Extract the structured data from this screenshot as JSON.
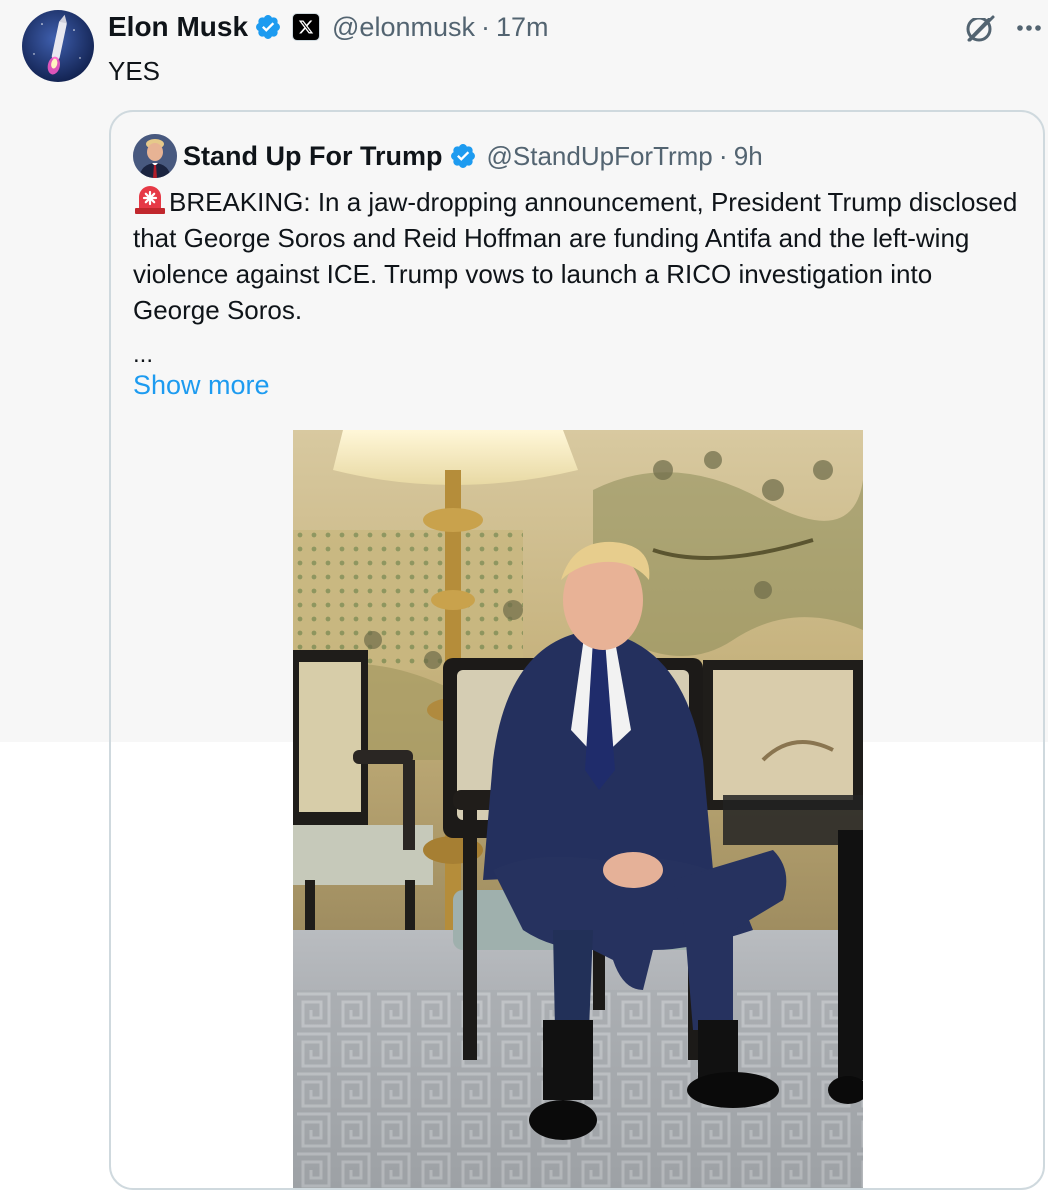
{
  "post": {
    "author": {
      "display_name": "Elon Musk",
      "handle": "@elonmusk",
      "verified": true,
      "affiliation_icon": "x-logo-icon"
    },
    "separator": "·",
    "time": "17m",
    "text": "YES",
    "actions": {
      "grok_icon": "grok-icon",
      "more_icon": "more-dots-icon"
    }
  },
  "quoted_post": {
    "author": {
      "display_name": "Stand Up For Trump",
      "handle": "@StandUpForTrmp",
      "verified": true
    },
    "separator": "·",
    "time": "9h",
    "alert_icon": "rotating-light-emoji",
    "text": "BREAKING: In a jaw-dropping announcement, President Trump disclosed that George Soros and Reid Hoffman are funding Antifa and the left-wing violence against ICE. Trump vows to launch a RICO investigation into George Soros.",
    "ellipsis": "...",
    "show_more_label": "Show more",
    "media": "photo"
  },
  "colors": {
    "accent": "#1d9bf0",
    "secondary_text": "#536471",
    "primary_text": "#0f1419",
    "border": "#cfd9de",
    "top_background": "#f7f7f7"
  }
}
